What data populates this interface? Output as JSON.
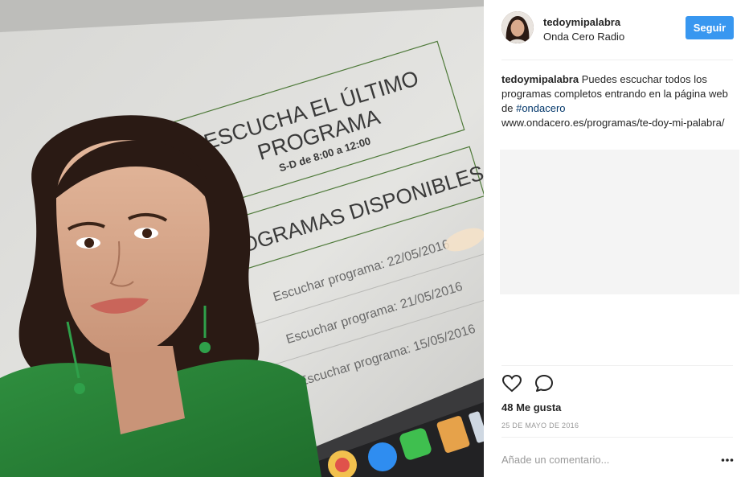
{
  "photo": {
    "screen_title_line1": "ESCUCHA EL ÚLTIMO",
    "screen_title_line2": "PROGRAMA",
    "schedule": "S-D de 8:00 a 12:00",
    "available_heading": "PROGRAMAS DISPONIBLES",
    "episodes": [
      "Escuchar programa: 22/05/2016",
      "Escuchar programa: 21/05/2016",
      "Escuchar programa: 15/05/2016"
    ]
  },
  "header": {
    "username": "tedoymipalabra",
    "location": "Onda Cero Radio",
    "follow_label": "Seguir"
  },
  "caption": {
    "username": "tedoymipalabra",
    "text_before_hashtag": "Puedes escuchar todos los programas completos entrando en la página web de",
    "hashtag": "#ondacero",
    "url": "www.ondacero.es/programas/te-doy-mi-palabra/"
  },
  "actions": {
    "like_icon": "heart-icon",
    "comment_icon": "comment-icon",
    "more_icon": "more-options-icon"
  },
  "likes_text": "48 Me gusta",
  "date_text": "25 DE MAYO DE 2016",
  "comment_placeholder": "Añade un comentario...",
  "colors": {
    "follow_button": "#3897f0",
    "hashtag": "#003569",
    "muted_text": "#999999",
    "divider": "#efefef",
    "screen_green": "#4f7a3a"
  }
}
